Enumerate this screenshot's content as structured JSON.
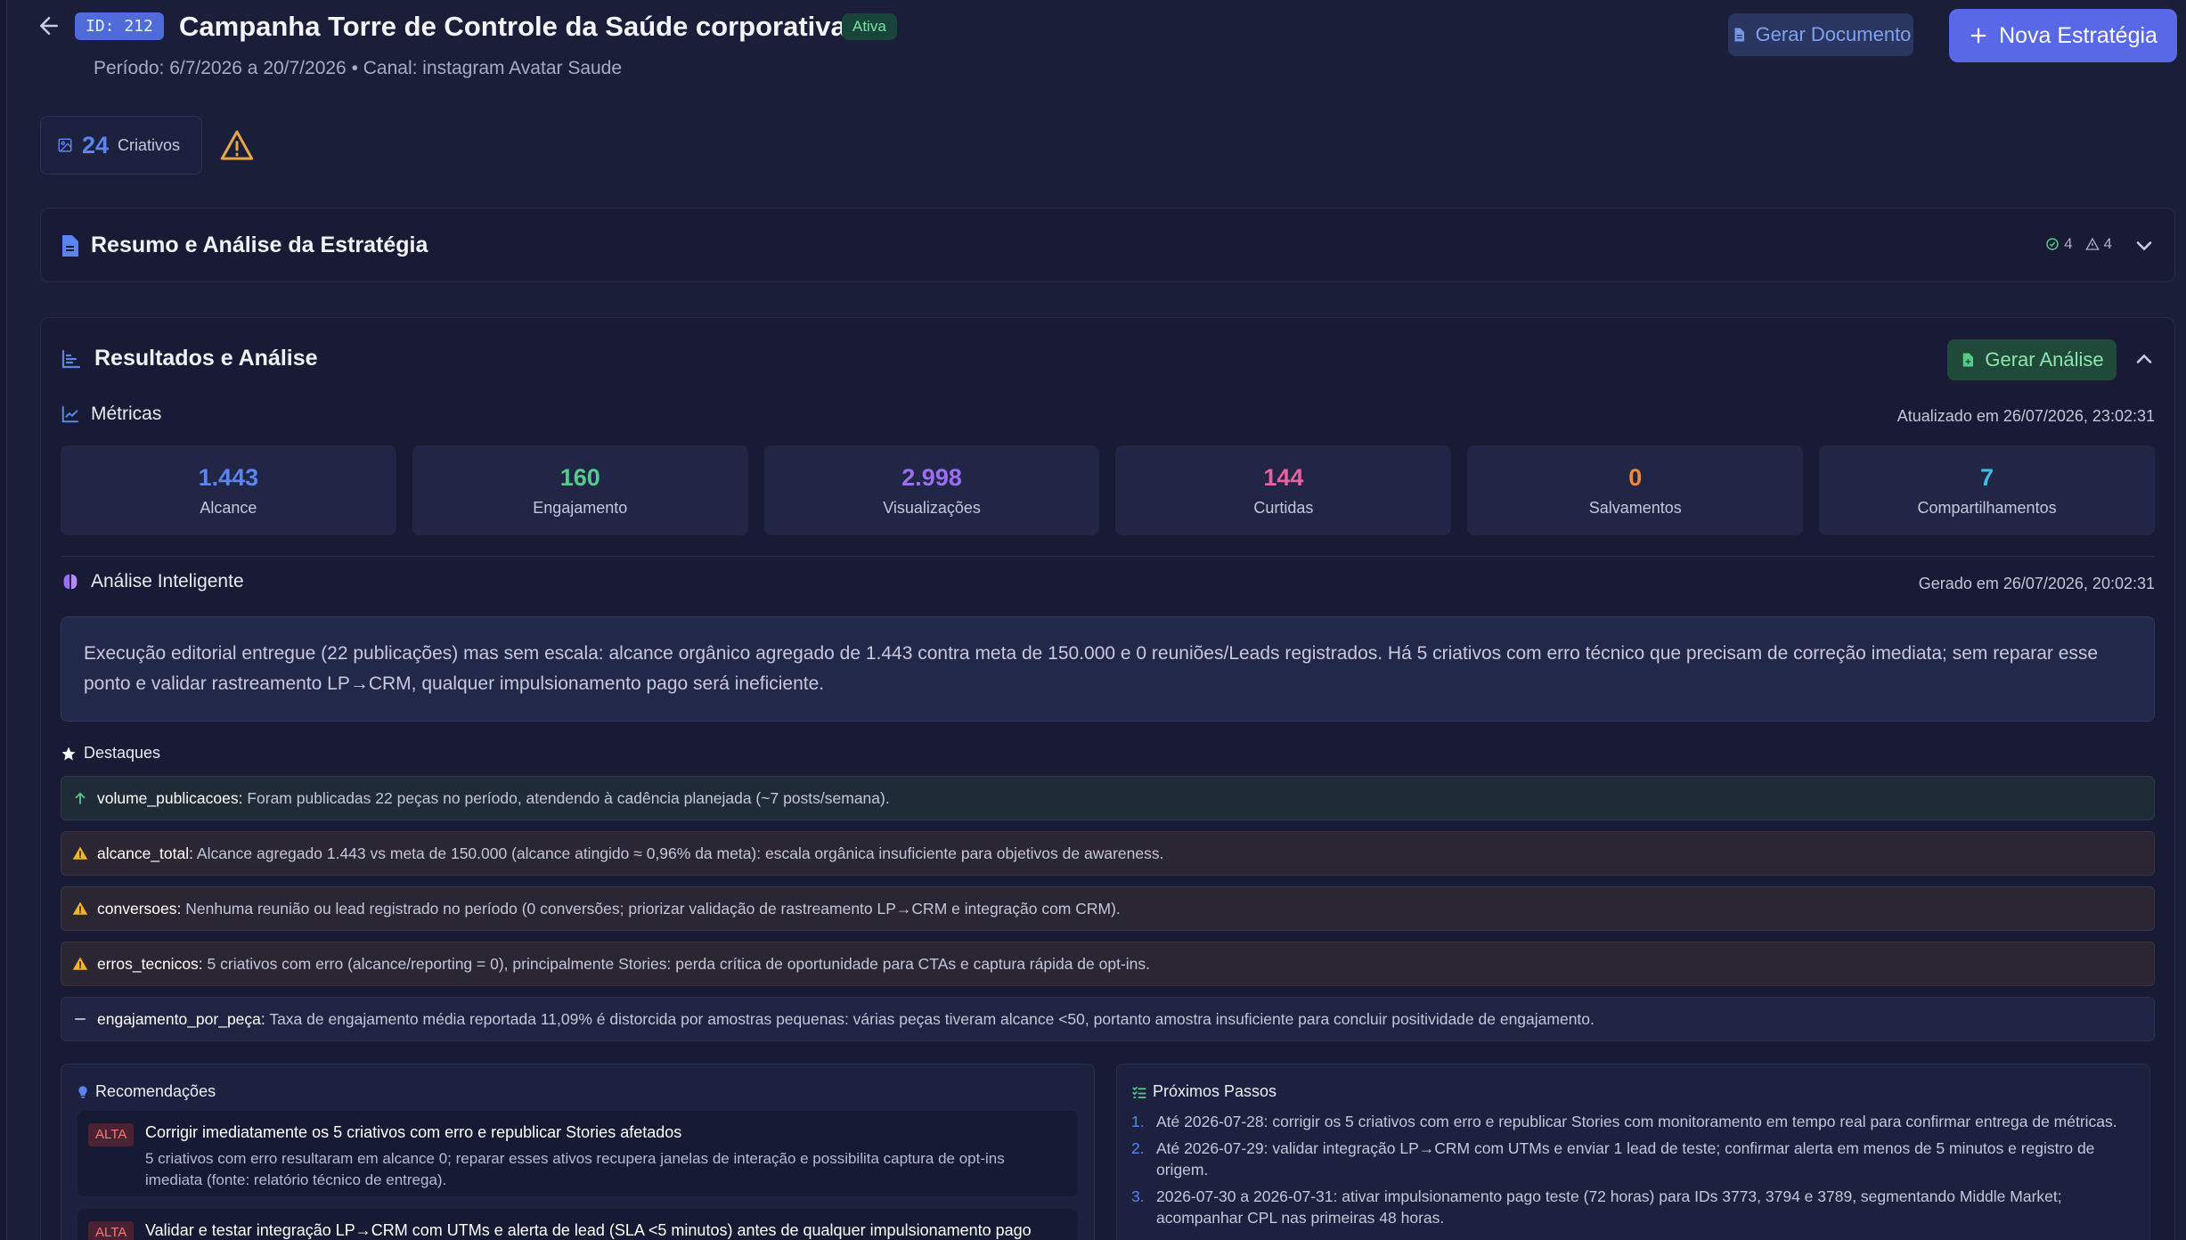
{
  "header": {
    "id_badge": "ID: 212",
    "title": "Campanha Torre de Controle da Saúde corporativa",
    "status": "Ativa",
    "subtitle": "Período: 6/7/2026 a 20/7/2026 • Canal: instagram Avatar Saude",
    "gerar_documento": "Gerar Documento",
    "nova_estrategia": "Nova Estratégia"
  },
  "stats": {
    "criativos_count": "24",
    "criativos_label": "Criativos"
  },
  "resumo_panel": {
    "title": "Resumo e Análise da Estratégia",
    "ok_count": "4",
    "warn_count": "4"
  },
  "resultados_panel": {
    "title": "Resultados e Análise",
    "gerar_analise": "Gerar Análise",
    "metricas_title": "Métricas",
    "metricas_updated": "Atualizado em 26/07/2026, 23:02:31",
    "metrics": [
      {
        "value": "1.443",
        "label": "Alcance",
        "color": "#5a84f0"
      },
      {
        "value": "160",
        "label": "Engajamento",
        "color": "#57c98a"
      },
      {
        "value": "2.998",
        "label": "Visualizações",
        "color": "#9a6ef0"
      },
      {
        "value": "144",
        "label": "Curtidas",
        "color": "#ea5f9c"
      },
      {
        "value": "0",
        "label": "Salvamentos",
        "color": "#f08a3a"
      },
      {
        "value": "7",
        "label": "Compartilhamentos",
        "color": "#3fbde8"
      }
    ],
    "analise_title": "Análise Inteligente",
    "analise_generated": "Gerado em 26/07/2026, 20:02:31",
    "analise_text": "Execução editorial entregue (22 publicações) mas sem escala: alcance orgânico agregado de 1.443 contra meta de 150.000 e 0 reuniões/Leads registrados. Há 5 criativos com erro técnico que precisam de correção imediata; sem reparar esse ponto e validar rastreamento LP→CRM, qualquer impulsionamento pago será ineficiente.",
    "destaques_title": "Destaques",
    "destaques": [
      {
        "key": "volume_publicacoes:",
        "text": "Foram publicadas 22 peças no período, atendendo à cadência planejada (~7 posts/semana).",
        "kind": "up"
      },
      {
        "key": "alcance_total:",
        "text": "Alcance agregado 1.443 vs meta de 150.000 (alcance atingido ≈ 0,96% da meta): escala orgânica insuficiente para objetivos de awareness.",
        "kind": "warn"
      },
      {
        "key": "conversoes:",
        "text": "Nenhuma reunião ou lead registrado no período (0 conversões; priorizar validação de rastreamento LP→CRM e integração com CRM).",
        "kind": "warn"
      },
      {
        "key": "erros_tecnicos:",
        "text": "5 criativos com erro (alcance/reporting = 0), principalmente Stories: perda crítica de oportunidade para CTAs e captura rápida de opt-ins.",
        "kind": "warn"
      },
      {
        "key": "engajamento_por_peça:",
        "text": "Taxa de engajamento média reportada 11,09% é distorcida por amostras pequenas: várias peças tiveram alcance <50, portanto amostra insuficiente para concluir positividade de engajamento.",
        "kind": "neutral"
      }
    ],
    "recomendacoes_title": "Recomendações",
    "recomendacoes": [
      {
        "priority": "ALTA",
        "title": "Corrigir imediatamente os 5 criativos com erro e republicar Stories afetados",
        "desc": "5 criativos com erro resultaram em alcance 0; reparar esses ativos recupera janelas de interação e possibilita captura de opt-ins imediata (fonte: relatório técnico de entrega)."
      },
      {
        "priority": "ALTA",
        "title": "Validar e testar integração LP→CRM com UTMs e alerta de lead (SLA <5 minutos) antes de qualquer impulsionamento pago",
        "desc": ""
      }
    ],
    "proximos_title": "Próximos Passos",
    "proximos": [
      {
        "n": "1.",
        "text": "Até 2026-07-28: corrigir os 5 criativos com erro e republicar Stories com monitoramento em tempo real para confirmar entrega de métricas."
      },
      {
        "n": "2.",
        "text": "Até 2026-07-29: validar integração LP→CRM com UTMs e enviar 1 lead de teste; confirmar alerta em menos de 5 minutos e registro de origem."
      },
      {
        "n": "3.",
        "text": "2026-07-30 a 2026-07-31: ativar impulsionamento pago teste (72 horas) para IDs 3773, 3794 e 3789, segmentando Middle Market; acompanhar CPL nas primeiras 48 horas."
      }
    ]
  }
}
